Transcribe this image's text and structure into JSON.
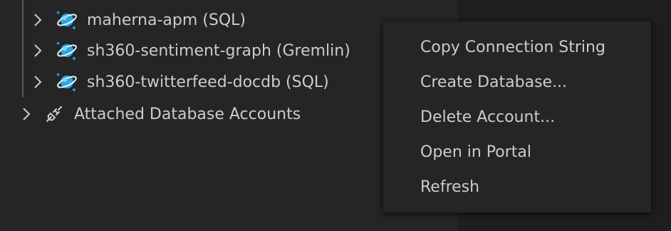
{
  "tree": {
    "accounts": [
      {
        "label": "maherna-apm (SQL)",
        "icon": "cosmos-db-icon"
      },
      {
        "label": "sh360-sentiment-graph (Gremlin)",
        "icon": "cosmos-db-icon"
      },
      {
        "label": "sh360-twitterfeed-docdb (SQL)",
        "icon": "cosmos-db-icon"
      }
    ],
    "attached": {
      "label": "Attached Database Accounts",
      "icon": "plug-icon"
    }
  },
  "context_menu": {
    "items": [
      {
        "label": "Copy Connection String"
      },
      {
        "label": "Create Database..."
      },
      {
        "label": "Delete Account..."
      },
      {
        "label": "Open in Portal"
      },
      {
        "label": "Refresh"
      }
    ]
  },
  "colors": {
    "background": "#252526",
    "editor_background": "#1e1e1e",
    "text": "#cccccc",
    "cosmos_blue": "#2aa8e0"
  }
}
